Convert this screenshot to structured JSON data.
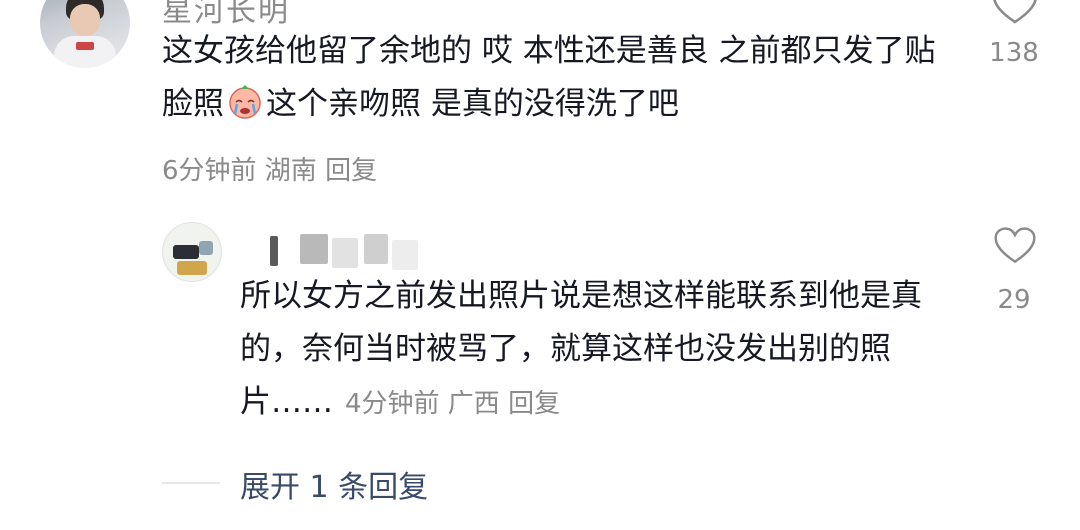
{
  "comment1": {
    "username": "星河长明",
    "text_part1": "这女孩给他留了余地的 哎 本性还是善良 之前都只发了贴脸照",
    "emoji": "crying-face-emoji",
    "text_part2": "这个亲吻照 是真的没得洗了吧",
    "meta": "6分钟前 湖南 回复",
    "likes": "138"
  },
  "reply1": {
    "text": "所以女方之前发出照片说是想这样能联系到他是真的，奈何当时被骂了，就算这样也没发出别的照片……",
    "meta": "4分钟前 广西 回复",
    "likes": "29"
  },
  "expand": {
    "label": "展开 1 条回复"
  }
}
